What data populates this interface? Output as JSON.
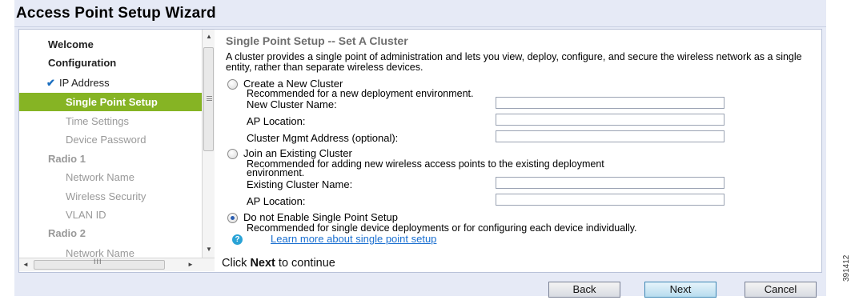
{
  "window": {
    "title": "Access Point Setup Wizard"
  },
  "nav": {
    "items": [
      {
        "label": "Welcome",
        "style": "bold"
      },
      {
        "label": "Configuration",
        "style": "bold"
      },
      {
        "label": "IP Address",
        "style": "done",
        "icon": "check-icon"
      },
      {
        "label": "Single Point Setup",
        "style": "active"
      },
      {
        "label": "Time Settings",
        "style": "gray"
      },
      {
        "label": "Device Password",
        "style": "gray"
      },
      {
        "label": "Radio 1",
        "style": "section"
      },
      {
        "label": "Network Name",
        "style": "gray"
      },
      {
        "label": "Wireless Security",
        "style": "gray"
      },
      {
        "label": "VLAN ID",
        "style": "gray"
      },
      {
        "label": "Radio 2",
        "style": "section"
      },
      {
        "label": "Network Name",
        "style": "gray"
      }
    ]
  },
  "main": {
    "heading": "Single Point Setup -- Set A Cluster",
    "description": "A cluster provides a single point of administration and lets you view, deploy, configure, and secure the wireless network as a single entity, rather than separate wireless devices.",
    "options": {
      "create": {
        "label": "Create a New Cluster",
        "sub": "Recommended for a new deployment environment.",
        "fields": {
          "name_label": "New Cluster Name:",
          "location_label": "AP Location:",
          "mgmt_label": "Cluster Mgmt Address (optional):"
        },
        "checked": false
      },
      "join": {
        "label": "Join an Existing Cluster",
        "sub_line1": "Recommended for adding new wireless access points to the existing deployment",
        "sub_line2": "environment.",
        "fields": {
          "name_label": "Existing Cluster Name:",
          "location_label": "AP Location:"
        },
        "checked": false
      },
      "disable": {
        "label": "Do not Enable Single Point Setup",
        "sub": "Recommended for single device deployments or for configuring each device individually.",
        "checked": true
      }
    },
    "help": {
      "icon": "help-icon",
      "link": "Learn more about single point setup"
    },
    "footer": {
      "prefix": "Click ",
      "emphasis": "Next",
      "suffix": " to continue"
    }
  },
  "buttons": {
    "back": "Back",
    "next": "Next",
    "cancel": "Cancel"
  },
  "figure_code": "391412",
  "colors": {
    "active_nav": "#86b424",
    "link": "#1a6fd0",
    "background": "#e6eaf6"
  }
}
